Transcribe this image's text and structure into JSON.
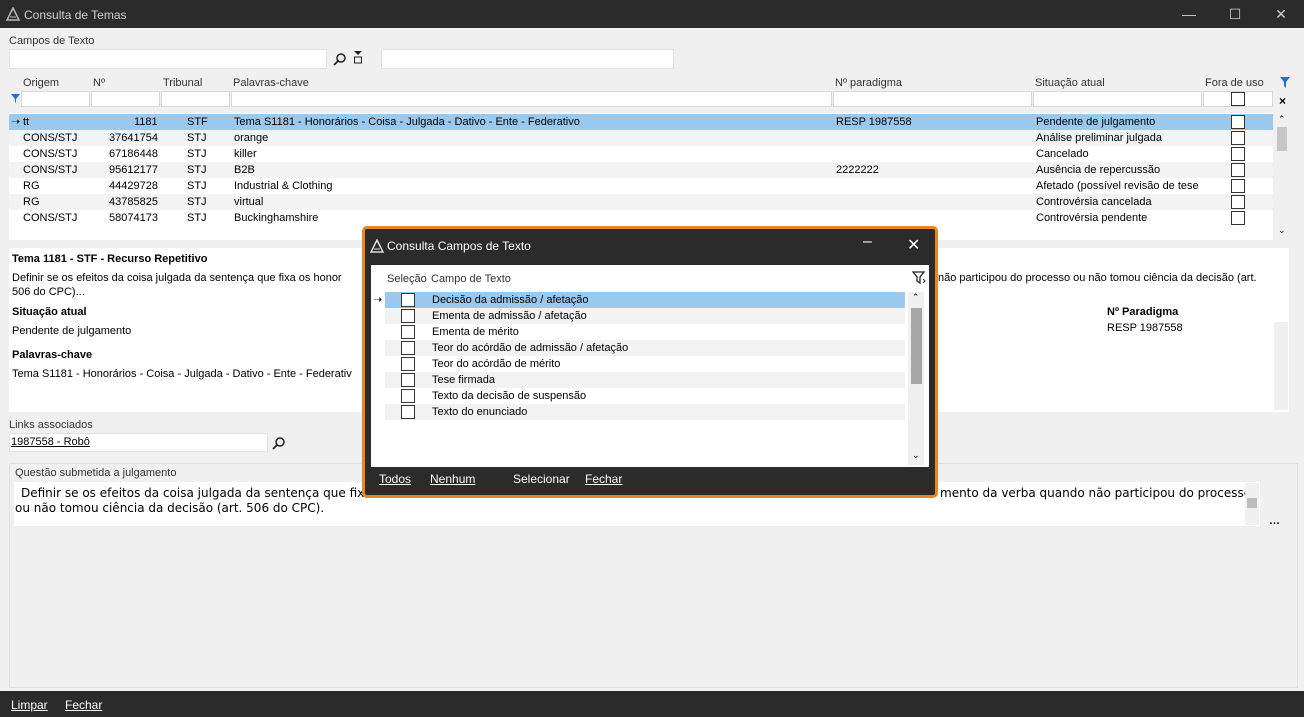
{
  "window": {
    "title": "Consulta de Temas",
    "min": "—",
    "max": "☐",
    "close": "✕"
  },
  "search": {
    "label": "Campos de Texto",
    "value": "",
    "value2": ""
  },
  "grid": {
    "headers": [
      "Origem",
      "Nº",
      "Tribunal",
      "Palavras-chave",
      "Nº paradigma",
      "Situação atual",
      "Fora de uso"
    ],
    "rows": [
      {
        "origem": "tt",
        "num": "1181",
        "tribunal": "STF",
        "palavras": "Tema S1181 - Honorários - Coisa - Julgada - Dativo - Ente - Federativo",
        "paradigma": "RESP 1987558",
        "situacao": "Pendente de julgamento"
      },
      {
        "origem": "CONS/STJ",
        "num": "37641754",
        "tribunal": "STJ",
        "palavras": "orange",
        "paradigma": "",
        "situacao": "Análise preliminar julgada"
      },
      {
        "origem": "CONS/STJ",
        "num": "67186448",
        "tribunal": "STJ",
        "palavras": "killer",
        "paradigma": "",
        "situacao": "Cancelado"
      },
      {
        "origem": "CONS/STJ",
        "num": "95612177",
        "tribunal": "STJ",
        "palavras": "B2B",
        "paradigma": "2222222",
        "situacao": "Ausência de repercussão"
      },
      {
        "origem": "RG",
        "num": "44429728",
        "tribunal": "STJ",
        "palavras": "Industrial & Clothing",
        "paradigma": "",
        "situacao": "Afetado (possível revisão de tese"
      },
      {
        "origem": "RG",
        "num": "43785825",
        "tribunal": "STJ",
        "palavras": "virtual",
        "paradigma": "",
        "situacao": "Controvérsia cancelada"
      },
      {
        "origem": "CONS/STJ",
        "num": "58074173",
        "tribunal": "STJ",
        "palavras": "Buckinghamshire",
        "paradigma": "",
        "situacao": "Controvérsia pendente"
      }
    ]
  },
  "detail": {
    "title": "Tema 1181 - STF - Recurso Repetitivo",
    "text_left": "Definir se os efeitos da coisa julgada da sentença que fixa os honor",
    "text_right": "não participou do processo ou não tomou ciência da decisão (art.",
    "text_line2": "506 do CPC)...",
    "situacao_label": "Situação atual",
    "situacao_value": "Pendente de julgamento",
    "palavras_label": "Palavras-chave",
    "palavras_value": "Tema S1181 - Honorários - Coisa - Julgada - Dativo - Ente - Federativ",
    "paradigma_label": "Nº Paradigma",
    "paradigma_value": "RESP 1987558"
  },
  "links": {
    "label": "Links associados",
    "value": "1987558 - Robô"
  },
  "questao": {
    "label": "Questão submetida a julgamento",
    "line1_left": "Definir se os efeitos da coisa julgada da sentença que fixa",
    "line1_right": "mento da verba quando não participou do processo",
    "line2": "ou não tomou ciência da decisão (art. 506 do CPC)."
  },
  "bottom": {
    "limpar": "Limpar",
    "fechar": "Fechar"
  },
  "dialog": {
    "title": "Consulta Campos de Texto",
    "headers": [
      "Seleção",
      "Campo de Texto"
    ],
    "items": [
      "Decisão da admissão / afetação",
      "Ementa de admissão / afetação",
      "Ementa de mérito",
      "Teor do acórdão de admissão / afetação",
      "Teor do acórdão de mérito",
      "Tese firmada",
      "Texto da decisão de suspensão",
      "Texto do enunciado"
    ],
    "footer": {
      "todos": "Todos",
      "nenhum": "Nenhum",
      "selecionar": "Selecionar",
      "fechar": "Fechar"
    }
  },
  "colors": {
    "accent_orange": "#e88622",
    "selected_row": "#99c9ef",
    "titlebar": "#2b2b2b"
  }
}
